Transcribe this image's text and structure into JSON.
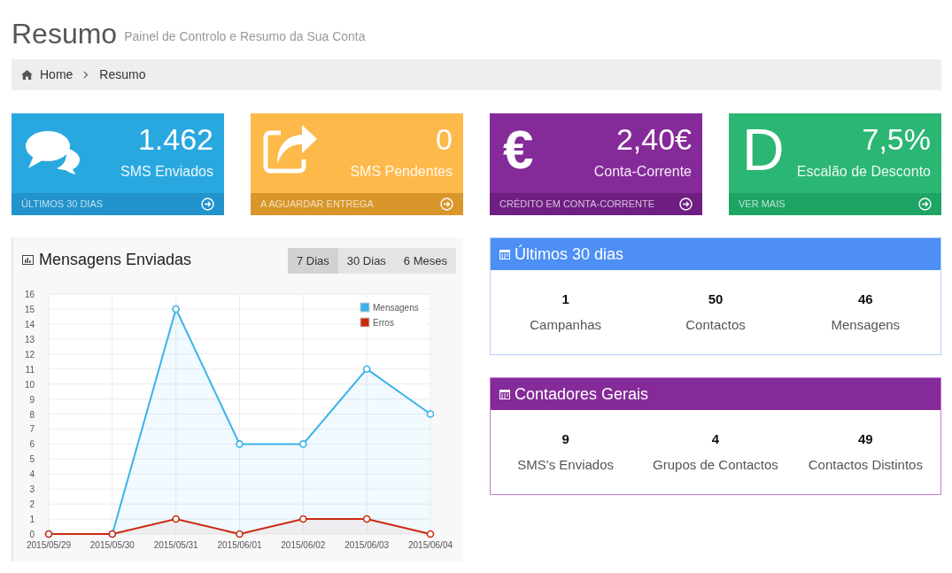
{
  "header": {
    "title": "Resumo",
    "subtitle": "Painel de Controlo e Resumo da Sua Conta"
  },
  "breadcrumb": [
    {
      "label": "Home"
    },
    {
      "label": "Resumo"
    }
  ],
  "cards": [
    {
      "icon": {
        "kind": "chat"
      },
      "value": "1.462",
      "label": "SMS Enviados",
      "footer": "ÚLTIMOS 30 DIAS",
      "color": "#29a8e0"
    },
    {
      "icon": {
        "kind": "share"
      },
      "value": "0",
      "label": "SMS Pendentes",
      "footer": "A AGUARDAR ENTREGA",
      "color": "#fdb94a"
    },
    {
      "icon": {
        "kind": "glyph",
        "text": "€"
      },
      "value": "2,40€",
      "label": "Conta-Corrente",
      "footer": "CRÉDITO EM CONTA-CORRENTE",
      "color": "#852a99"
    },
    {
      "icon": {
        "kind": "glyph",
        "text": "D"
      },
      "value": "7,5%",
      "label": "Escalão de Desconto",
      "footer": "VER MAIS",
      "color": "#2bb673"
    }
  ],
  "chart_panel": {
    "title": "Mensagens Enviadas",
    "tabs": [
      {
        "label": "7 Dias",
        "selected": true
      },
      {
        "label": "30 Dias",
        "selected": false
      },
      {
        "label": "6 Meses",
        "selected": false
      }
    ],
    "chart_data": {
      "type": "area",
      "categories": [
        "2015/05/29",
        "2015/05/30",
        "2015/05/31",
        "2015/06/01",
        "2015/06/02",
        "2015/06/03",
        "2015/06/04"
      ],
      "series": [
        {
          "name": "Mensagens",
          "color": "#3bb3ea",
          "values": [
            0,
            0,
            15,
            6,
            6,
            11,
            8
          ]
        },
        {
          "name": "Erros",
          "color": "#cc2a10",
          "values": [
            0,
            0,
            1,
            0,
            1,
            1,
            0
          ]
        }
      ],
      "grid": true,
      "legend": true,
      "ylim": [
        0,
        16
      ],
      "yticks": [
        {
          "value": 0,
          "label": "0"
        },
        {
          "value": 1,
          "label": "1"
        },
        {
          "value": 2,
          "label": "2"
        },
        {
          "value": 3,
          "label": "3"
        },
        {
          "value": 4,
          "label": "4"
        },
        {
          "value": 5,
          "label": "5"
        },
        {
          "value": 6,
          "label": "6"
        },
        {
          "value": 7,
          "label": "7"
        },
        {
          "value": 8,
          "label": "8"
        },
        {
          "value": 9,
          "label": "9"
        },
        {
          "value": 10,
          "label": "10"
        },
        {
          "value": 11,
          "label": "11"
        },
        {
          "value": 12,
          "label": "12"
        },
        {
          "value": 13,
          "label": "13"
        },
        {
          "value": 14,
          "label": "14"
        },
        {
          "value": 15,
          "label": "15"
        },
        {
          "value": 16,
          "label": "16"
        }
      ]
    }
  },
  "stat_panels": [
    {
      "title": "Últimos 30 dias",
      "color": "#4d8ff5",
      "stats": [
        {
          "value": "1",
          "label": "Campanhas"
        },
        {
          "value": "50",
          "label": "Contactos"
        },
        {
          "value": "46",
          "label": "Mensagens"
        }
      ]
    },
    {
      "title": "Contadores Gerais",
      "color": "#852a99",
      "stats": [
        {
          "value": "9",
          "label": "SMS's Enviados"
        },
        {
          "value": "4",
          "label": "Grupos de Contactos"
        },
        {
          "value": "49",
          "label": "Contactos Distintos"
        }
      ]
    }
  ]
}
